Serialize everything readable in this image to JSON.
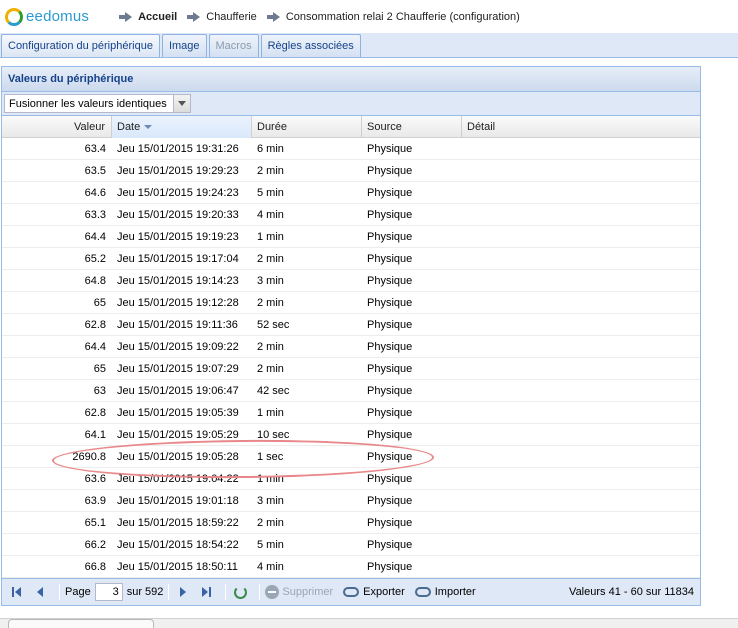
{
  "app": {
    "logo_text": "eedomus"
  },
  "breadcrumb": {
    "items": [
      {
        "label": "Accueil",
        "bold": true
      },
      {
        "label": "Chaufferie",
        "bold": false
      },
      {
        "label": "Consommation relai 2 Chaufferie (configuration)",
        "bold": false
      }
    ]
  },
  "tabs": [
    {
      "label": "Configuration du périphérique",
      "state": "active"
    },
    {
      "label": "Image",
      "state": "normal"
    },
    {
      "label": "Macros",
      "state": "disabled"
    },
    {
      "label": "Règles associées",
      "state": "normal"
    }
  ],
  "panel": {
    "title": "Valeurs du périphérique",
    "combo_value": "Fusionner les valeurs identiques"
  },
  "grid": {
    "columns": {
      "value": "Valeur",
      "date": "Date",
      "duration": "Durée",
      "source": "Source",
      "detail": "Détail"
    },
    "sorted_column": "date",
    "rows": [
      {
        "value": "63.4",
        "date": "Jeu 15/01/2015 19:31:26",
        "duration": "6 min",
        "source": "Physique",
        "detail": ""
      },
      {
        "value": "63.5",
        "date": "Jeu 15/01/2015 19:29:23",
        "duration": "2 min",
        "source": "Physique",
        "detail": ""
      },
      {
        "value": "64.6",
        "date": "Jeu 15/01/2015 19:24:23",
        "duration": "5 min",
        "source": "Physique",
        "detail": ""
      },
      {
        "value": "63.3",
        "date": "Jeu 15/01/2015 19:20:33",
        "duration": "4 min",
        "source": "Physique",
        "detail": ""
      },
      {
        "value": "64.4",
        "date": "Jeu 15/01/2015 19:19:23",
        "duration": "1 min",
        "source": "Physique",
        "detail": ""
      },
      {
        "value": "65.2",
        "date": "Jeu 15/01/2015 19:17:04",
        "duration": "2 min",
        "source": "Physique",
        "detail": ""
      },
      {
        "value": "64.8",
        "date": "Jeu 15/01/2015 19:14:23",
        "duration": "3 min",
        "source": "Physique",
        "detail": ""
      },
      {
        "value": "65",
        "date": "Jeu 15/01/2015 19:12:28",
        "duration": "2 min",
        "source": "Physique",
        "detail": ""
      },
      {
        "value": "62.8",
        "date": "Jeu 15/01/2015 19:11:36",
        "duration": "52 sec",
        "source": "Physique",
        "detail": ""
      },
      {
        "value": "64.4",
        "date": "Jeu 15/01/2015 19:09:22",
        "duration": "2 min",
        "source": "Physique",
        "detail": ""
      },
      {
        "value": "65",
        "date": "Jeu 15/01/2015 19:07:29",
        "duration": "2 min",
        "source": "Physique",
        "detail": ""
      },
      {
        "value": "63",
        "date": "Jeu 15/01/2015 19:06:47",
        "duration": "42 sec",
        "source": "Physique",
        "detail": ""
      },
      {
        "value": "62.8",
        "date": "Jeu 15/01/2015 19:05:39",
        "duration": "1 min",
        "source": "Physique",
        "detail": ""
      },
      {
        "value": "64.1",
        "date": "Jeu 15/01/2015 19:05:29",
        "duration": "10 sec",
        "source": "Physique",
        "detail": ""
      },
      {
        "value": "2690.8",
        "date": "Jeu 15/01/2015 19:05:28",
        "duration": "1 sec",
        "source": "Physique",
        "detail": ""
      },
      {
        "value": "63.6",
        "date": "Jeu 15/01/2015 19:04:22",
        "duration": "1 min",
        "source": "Physique",
        "detail": ""
      },
      {
        "value": "63.9",
        "date": "Jeu 15/01/2015 19:01:18",
        "duration": "3 min",
        "source": "Physique",
        "detail": ""
      },
      {
        "value": "65.1",
        "date": "Jeu 15/01/2015 18:59:22",
        "duration": "2 min",
        "source": "Physique",
        "detail": ""
      },
      {
        "value": "66.2",
        "date": "Jeu 15/01/2015 18:54:22",
        "duration": "5 min",
        "source": "Physique",
        "detail": ""
      },
      {
        "value": "66.8",
        "date": "Jeu 15/01/2015 18:50:11",
        "duration": "4 min",
        "source": "Physique",
        "detail": ""
      }
    ]
  },
  "pager": {
    "page_label": "Page",
    "page_value": "3",
    "of_label": "sur 592",
    "delete_label": "Supprimer",
    "export_label": "Exporter",
    "import_label": "Importer",
    "status": "Valeurs 41 - 60 sur 11834"
  },
  "colors": {
    "accent": "#15428b",
    "panel_border": "#99bbe8",
    "annotation": "#e8888a",
    "logo": "#2a9ad0"
  }
}
